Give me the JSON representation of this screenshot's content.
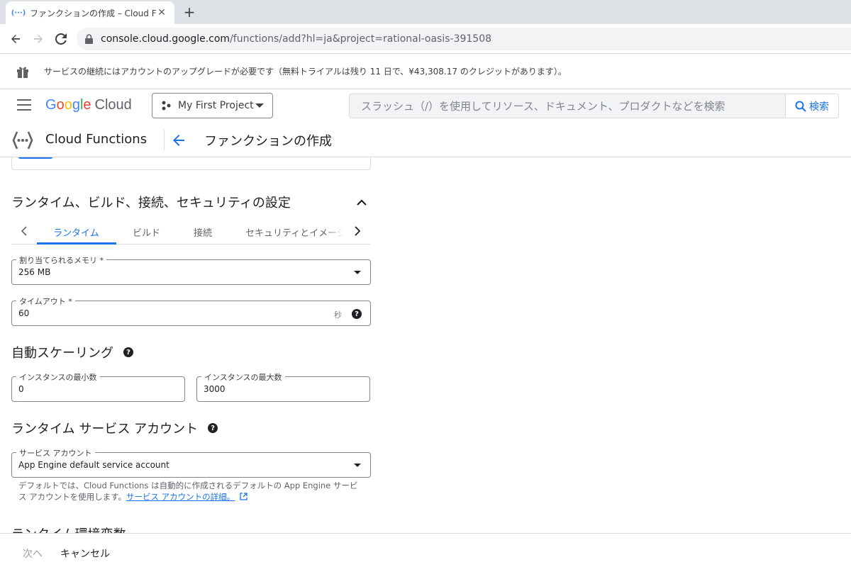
{
  "browser": {
    "tab_title": "ファンクションの作成 – Cloud Functions",
    "tab_favicon": "(···)",
    "new_tab_symbol": "+",
    "close_symbol": "✕",
    "url_host": "console.cloud.google.com",
    "url_rest": "/functions/add?hl=ja&project=rational-oasis-391508"
  },
  "banner": {
    "text": "サービスの継続にはアカウントのアップグレードが必要です（無料トライアルは残り 11 日で、¥43,308.17 のクレジットがあります）。"
  },
  "header": {
    "logo_letters": [
      "G",
      "o",
      "o",
      "g",
      "l",
      "e"
    ],
    "logo_cloud": "Cloud",
    "project": "My First Project",
    "search_placeholder": "スラッシュ（/）を使用してリソース、ドキュメント、プロダクトなどを検索",
    "search_button": "検索"
  },
  "product_bar": {
    "product_name": "Cloud Functions",
    "page_title": "ファンクションの作成"
  },
  "main": {
    "section_title": "ランタイム、ビルド、接続、セキュリティの設定",
    "tabs": [
      {
        "label": "ランタイム",
        "active": true
      },
      {
        "label": "ビルド",
        "active": false
      },
      {
        "label": "接続",
        "active": false
      },
      {
        "label": "セキュリティとイメージ",
        "active": false
      }
    ],
    "memory": {
      "label": "割り当てられるメモリ *",
      "value": "256 MB"
    },
    "timeout": {
      "label": "タイムアウト *",
      "value": "60",
      "suffix": "秒"
    },
    "autoscaling_title": "自動スケーリング",
    "min_instances": {
      "label": "インスタンスの最小数",
      "value": "0"
    },
    "max_instances": {
      "label": "インスタンスの最大数",
      "value": "3000"
    },
    "service_account_title": "ランタイム サービス アカウント",
    "service_account": {
      "label": "サービス アカウント",
      "value": "App Engine default service account"
    },
    "helper_text": "デフォルトでは、Cloud Functions は自動的に作成されるデフォルトの App Engine サービス アカウントを使用します。",
    "helper_link": "サービス アカウントの詳細。",
    "next_section_title": "ランタイム環境変数"
  },
  "footer": {
    "next": "次へ",
    "cancel": "キャンセル"
  },
  "colors": {
    "accent": "#1a73e8",
    "text": "#202124",
    "border": "#dadce0"
  }
}
